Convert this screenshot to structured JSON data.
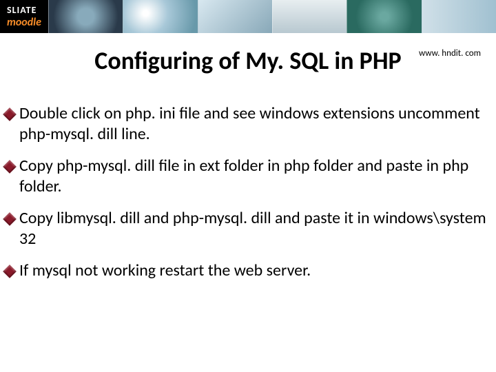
{
  "header": {
    "logo_line1": "SLIATE",
    "logo_line2": "moodle"
  },
  "title": "Configuring of My. SQL in PHP",
  "site_url": "www. hndit. com",
  "bullets": [
    "Double click on php. ini file and see windows extensions uncomment php-mysql. dill line.",
    "Copy php-mysql. dill file in ext folder in php folder and paste in php folder.",
    "Copy libmysql. dill and php-mysql. dill and paste it in windows\\system 32",
    "If mysql not working restart the web server."
  ]
}
